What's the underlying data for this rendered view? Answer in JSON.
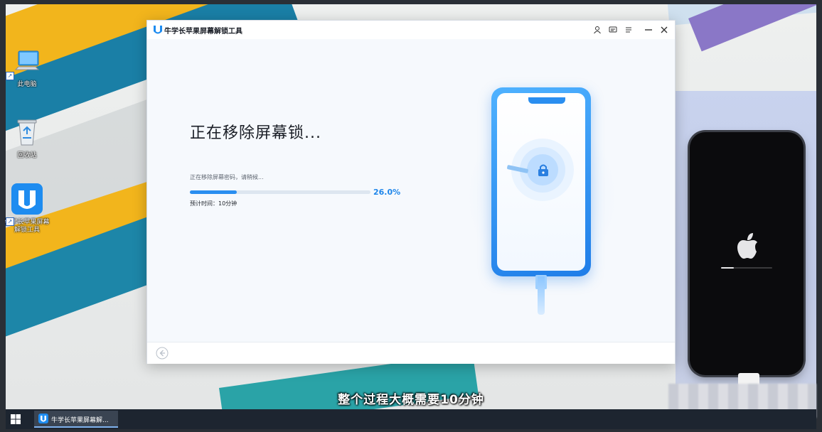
{
  "desktop": {
    "icons": [
      {
        "label": "此电脑"
      },
      {
        "label": "回收站"
      },
      {
        "label": "牛学长苹果屏幕解锁工具"
      }
    ]
  },
  "app": {
    "title": "牛学长苹果屏幕解锁工具",
    "toolbar_icons": [
      "user-icon",
      "feedback-icon",
      "menu-icon",
      "minimize-icon",
      "close-icon"
    ],
    "heading": "正在移除屏幕锁...",
    "status_text": "正在移除屏幕密码，请稍候...",
    "progress_fraction": 0.26,
    "progress_label": "26.0%",
    "eta_label": "预计时间：10分钟"
  },
  "subtitle": "整个过程大概需要10分钟",
  "taskbar": {
    "active_app_label": "牛学长苹果屏幕解..."
  },
  "colors": {
    "accent": "#2a8ef0",
    "accent_text": "#1e86ea",
    "taskbar": "#1d2530"
  }
}
